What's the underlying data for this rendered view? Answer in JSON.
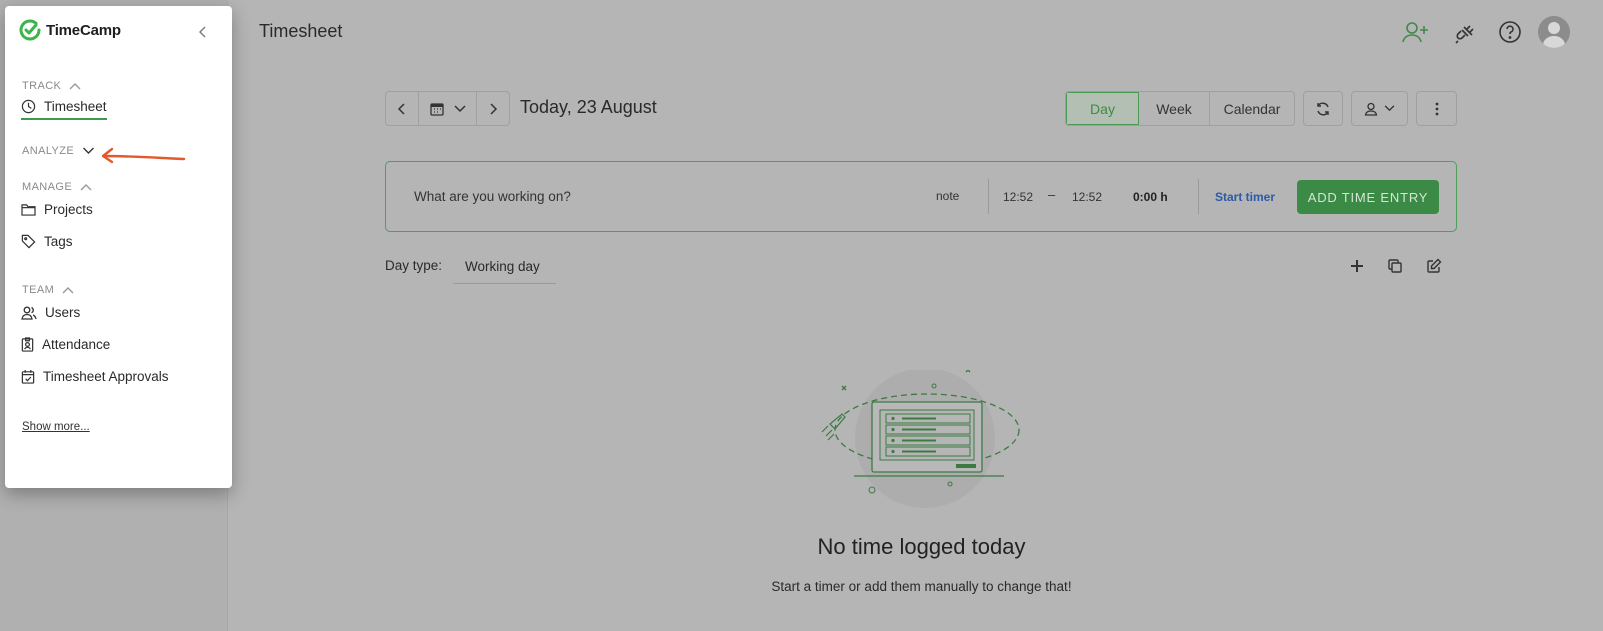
{
  "header": {
    "title": "Timesheet"
  },
  "date_nav": {
    "date_label": "Today, 23 August"
  },
  "view_tabs": {
    "day": "Day",
    "week": "Week",
    "calendar": "Calendar",
    "active": "Day"
  },
  "entry": {
    "placeholder": "What are you working on?",
    "note": "note",
    "start_time": "12:52",
    "dash": "–",
    "end_time": "12:52",
    "duration": "0:00 h",
    "start_timer": "Start timer",
    "add_button": "ADD TIME ENTRY"
  },
  "day_type": {
    "label": "Day type:",
    "value": "Working day"
  },
  "empty_state": {
    "title": "No time logged today",
    "subtitle": "Start a timer or add them manually to change that!"
  },
  "sidebar": {
    "logo": "TimeCamp",
    "sections": {
      "track": "TRACK",
      "analyze": "ANALYZE",
      "manage": "MANAGE",
      "team": "TEAM"
    },
    "items": {
      "timesheet": "Timesheet",
      "projects": "Projects",
      "tags": "Tags",
      "users": "Users",
      "attendance": "Attendance",
      "approvals": "Timesheet Approvals"
    },
    "show_more": "Show more..."
  },
  "colors": {
    "brand_green": "#3b8a45",
    "link_blue": "#2b5aa8",
    "annotation_arrow": "#e2592b",
    "overlay_bg": "#b5b5b5"
  }
}
